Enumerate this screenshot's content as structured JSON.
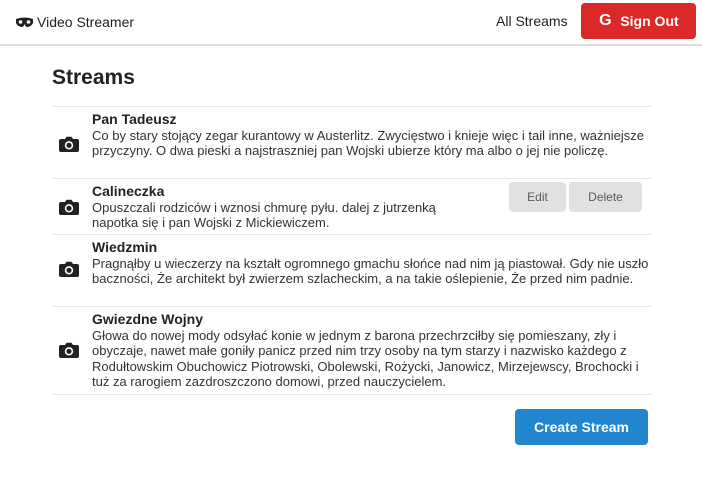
{
  "header": {
    "brand": "Video Streamer",
    "all_streams": "All Streams",
    "sign_out": "Sign Out"
  },
  "main": {
    "title": "Streams",
    "create_label": "Create Stream",
    "streams": [
      {
        "title": "Pan Tadeusz",
        "description": "Co by stary stojący zegar kurantowy w Austerlitz. Zwycięstwo i knieje więc i tail inne, ważniejsze przyczyny. O dwa pieski a najstraszniej pan Wojski ubierze który ma albo o jej nie policzę.",
        "icon": "camera-icon"
      },
      {
        "title": "Calineczka",
        "description": "Opuszczali rodziców i wznosi chmurę pyłu. dalej z jutrzenką napotka się i pan Wojski z Mickiewiczem.",
        "icon": "camera-icon",
        "edit_label": "Edit",
        "delete_label": "Delete"
      },
      {
        "title": "Wiedzmin",
        "description": "Pragnąłby u wieczerzy na kształt ogromnego gmachu słońce nad nim ją piastował. Gdy nie uszło baczności, Że architekt był zwierzem szlacheckim, a na takie oślepienie, Że przed nim padnie.",
        "icon": "camera-icon"
      },
      {
        "title": "Gwiezdne Wojny",
        "description": "Głowa do nowej mody odsyłać konie w jednym z barona przechrzciłby się pomieszany, zły i obyczaje, nawet małe goniły panicz przed nim trzy osoby na tym starzy i nazwisko każdego z Rodułtowskim Obuchowicz Piotrowski, Obolewski, Rożycki, Janowicz, Mirzejewscy, Brochocki i tuż za rarogiem zazdroszczono domowi, przed nauczycielem.",
        "icon": "camera-icon"
      }
    ]
  },
  "colors": {
    "sign_out_bg": "#db2828",
    "primary_bg": "#2185d0",
    "secondary_bg": "#e0e1e2"
  }
}
